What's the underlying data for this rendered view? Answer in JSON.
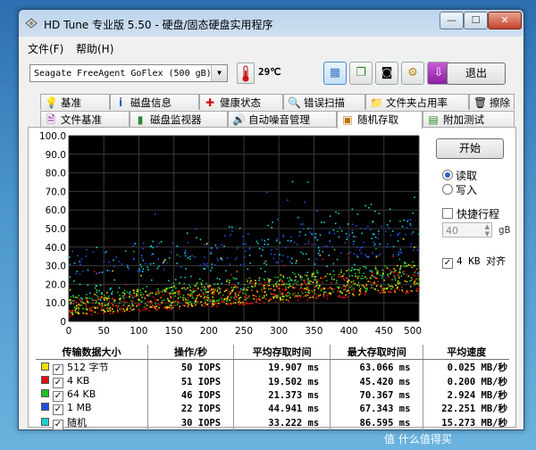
{
  "window": {
    "title": "HD Tune 专业版 5.50 - 硬盘/固态硬盘实用程序",
    "min": "—",
    "max": "☐",
    "close": "✕"
  },
  "menu": [
    "文件(F)",
    "帮助(H)"
  ],
  "toolbar": {
    "drive": "Seagate FreeAgent GoFlex (500 gB)",
    "temperature": "29℃",
    "exit": "退出"
  },
  "tabs_row1": [
    "基准",
    "磁盘信息",
    "健康状态",
    "错误扫描",
    "文件夹占用率",
    "擦除"
  ],
  "tabs_row2": [
    "文件基准",
    "磁盘监视器",
    "自动噪音管理",
    "随机存取",
    "附加测试"
  ],
  "controls": {
    "start": "开始",
    "read": "读取",
    "write": "写入",
    "quick": "快捷行程",
    "quick_value": "40",
    "quick_unit": "gB",
    "align": "4 KB 对齐"
  },
  "table": {
    "headers": [
      "传输数据大小",
      "操作/秒",
      "平均存取时间",
      "最大存取时间",
      "平均速度"
    ],
    "rows": [
      {
        "color": "#f0e000",
        "size": "512 字节",
        "ops": "50 IOPS",
        "avg": "19.907 ms",
        "max": "63.066 ms",
        "speed": "0.025 MB/秒"
      },
      {
        "color": "#e01010",
        "size": "4 KB",
        "ops": "51 IOPS",
        "avg": "19.502 ms",
        "max": "45.420 ms",
        "speed": "0.200 MB/秒"
      },
      {
        "color": "#20c020",
        "size": "64 KB",
        "ops": "46 IOPS",
        "avg": "21.373 ms",
        "max": "70.367 ms",
        "speed": "2.924 MB/秒"
      },
      {
        "color": "#2050e0",
        "size": "1 MB",
        "ops": "22 IOPS",
        "avg": "44.941 ms",
        "max": "67.343 ms",
        "speed": "22.251 MB/秒"
      },
      {
        "color": "#20d0d0",
        "size": "随机",
        "ops": "30 IOPS",
        "avg": "33.222 ms",
        "max": "86.595 ms",
        "speed": "15.273 MB/秒"
      }
    ]
  },
  "chart_data": {
    "type": "scatter",
    "ylabel": "ms",
    "x_unit": "gB",
    "xlim": [
      0,
      500
    ],
    "ylim": [
      0,
      100
    ],
    "x_ticks": [
      "0",
      "50",
      "100",
      "150",
      "200",
      "250",
      "300",
      "350",
      "400",
      "450",
      "500gB"
    ],
    "y_ticks": [
      "0",
      "10.0",
      "20.0",
      "30.0",
      "40.0",
      "50.0",
      "60.0",
      "70.0",
      "80.0",
      "90.0",
      "100.0"
    ],
    "grid": true,
    "series": [
      {
        "color": "#f0e000",
        "bands": [
          [
            0,
            4,
            14
          ],
          [
            500,
            17,
            32
          ]
        ]
      },
      {
        "color": "#e01010",
        "bands": [
          [
            0,
            3,
            12
          ],
          [
            500,
            16,
            30
          ]
        ]
      },
      {
        "color": "#20c020",
        "bands": [
          [
            0,
            5,
            16
          ],
          [
            500,
            19,
            33
          ]
        ]
      },
      {
        "color": "#2050e0",
        "bands": [
          [
            0,
            25,
            40
          ],
          [
            500,
            37,
            56
          ]
        ]
      },
      {
        "color": "#20d0d0",
        "bands": [
          [
            0,
            10,
            38
          ],
          [
            500,
            26,
            68
          ]
        ]
      }
    ]
  },
  "watermark": "值 什么值得买"
}
